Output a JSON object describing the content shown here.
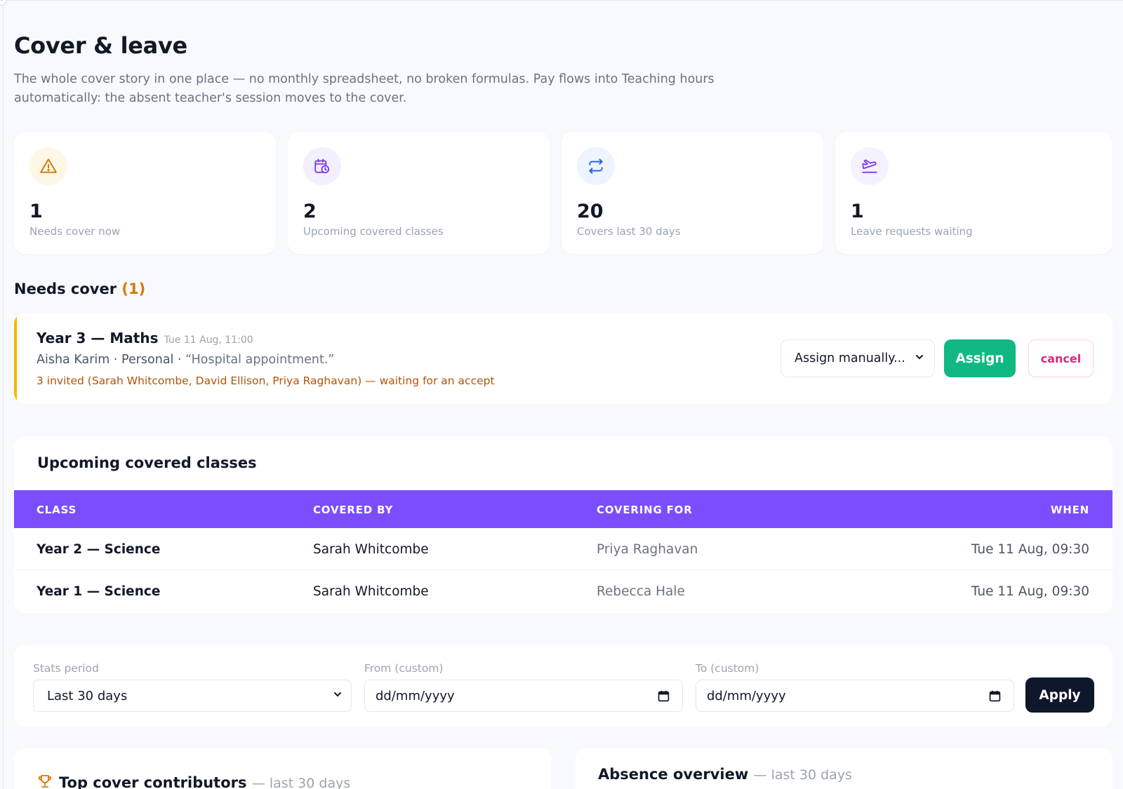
{
  "page": {
    "title": "Cover & leave",
    "subtitle": "The whole cover story in one place — no monthly spreadsheet, no broken formulas. Pay flows into Teaching hours automatically: the absent teacher's session moves to the cover."
  },
  "stats": [
    {
      "icon": "warning-icon",
      "value": "1",
      "label": "Needs cover now",
      "color": "#d97706",
      "bg": "#fef7e6"
    },
    {
      "icon": "calendar-clock-icon",
      "value": "2",
      "label": "Upcoming covered classes",
      "color": "#7c3aed",
      "bg": "#f3efff"
    },
    {
      "icon": "swap-arrows-icon",
      "value": "20",
      "label": "Covers last 30 days",
      "color": "#2563eb",
      "bg": "#eef4ff"
    },
    {
      "icon": "plane-departure-icon",
      "value": "1",
      "label": "Leave requests waiting",
      "color": "#7c3aed",
      "bg": "#f5f1ff"
    }
  ],
  "needs_cover": {
    "heading": "Needs cover",
    "count": "(1)",
    "item": {
      "title": "Year 3 — Maths",
      "time": "Tue 11 Aug, 11:00",
      "teacher_type": "Aisha Karim · Personal ·",
      "reason": "“Hospital appointment.”",
      "invited": "3 invited (Sarah Whitcombe, David Ellison, Priya Raghavan) — waiting for an accept",
      "assign_select": "Assign manually...",
      "assign_label": "Assign",
      "cancel_label": "cancel"
    }
  },
  "upcoming": {
    "title": "Upcoming covered classes",
    "columns": [
      "CLASS",
      "COVERED BY",
      "COVERING FOR",
      "WHEN"
    ],
    "rows": [
      {
        "class": "Year 2 — Science",
        "covered_by": "Sarah Whitcombe",
        "covering_for": "Priya Raghavan",
        "when": "Tue 11 Aug, 09:30"
      },
      {
        "class": "Year 1 — Science",
        "covered_by": "Sarah Whitcombe",
        "covering_for": "Rebecca Hale",
        "when": "Tue 11 Aug, 09:30"
      }
    ]
  },
  "filters": {
    "period_label": "Stats period",
    "period_value": "Last 30 days",
    "from_label": "From (custom)",
    "from_placeholder": "dd/mm/yyyy",
    "to_label": "To (custom)",
    "to_placeholder": "dd/mm/yyyy",
    "apply_label": "Apply"
  },
  "bottom": {
    "contributors_title": "Top cover contributors",
    "contributors_suffix": "— last 30 days",
    "absence_title": "Absence overview",
    "absence_suffix": "— last 30 days"
  },
  "colors": {
    "accent_purple": "#7c4dff",
    "assign_green": "#10b981",
    "warning_amber": "#f5b700",
    "apply_dark": "#0f172a"
  }
}
